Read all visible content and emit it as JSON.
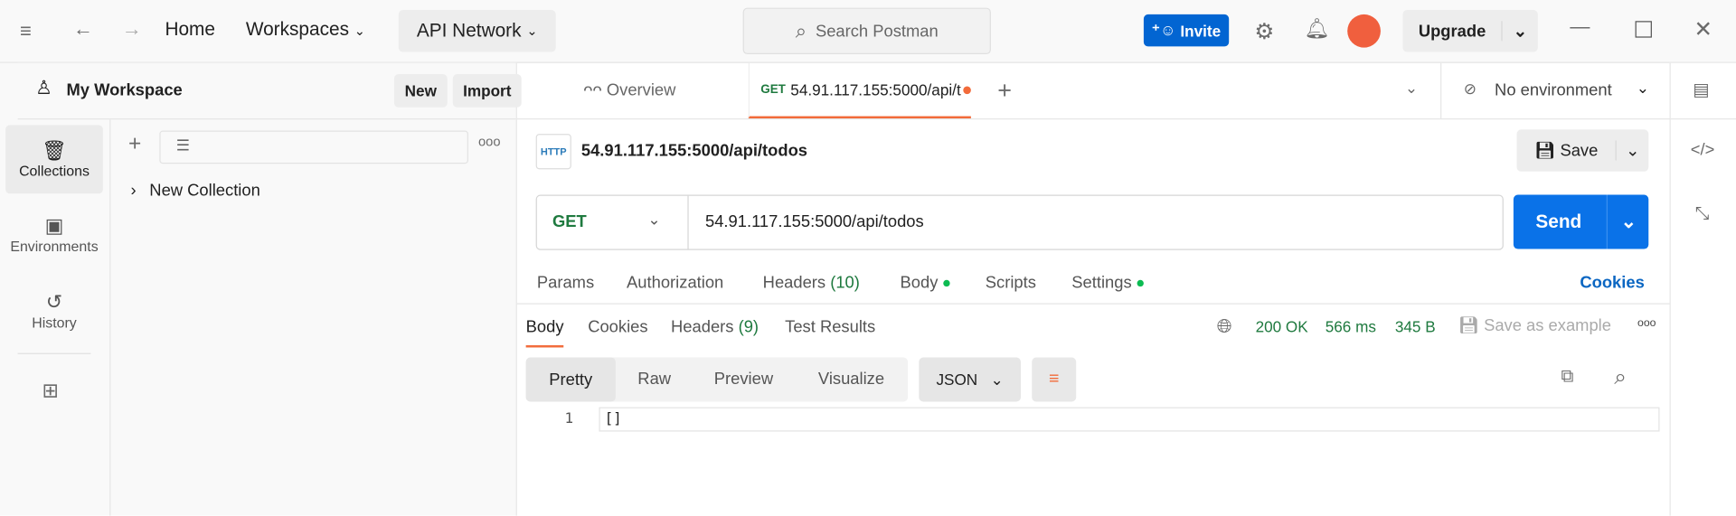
{
  "topbar": {
    "home": "Home",
    "workspaces": "Workspaces",
    "api_network": "API Network",
    "search_placeholder": "Search Postman",
    "invite": "Invite",
    "upgrade": "Upgrade"
  },
  "workspace": {
    "title": "My Workspace",
    "new": "New",
    "import": "Import"
  },
  "nav": [
    {
      "label": "Collections"
    },
    {
      "label": "Environments"
    },
    {
      "label": "History"
    }
  ],
  "collections": [
    {
      "name": "New Collection"
    }
  ],
  "tabs": {
    "overview": "Overview",
    "request_method": "GET",
    "request_title": "54.91.117.155:5000/api/t",
    "environment": "No environment"
  },
  "request": {
    "name": "54.91.117.155:5000/api/todos",
    "method": "GET",
    "url": "54.91.117.155:5000/api/todos",
    "save": "Save",
    "send": "Send",
    "http_badge": "HTTP"
  },
  "request_tabs": [
    "Params",
    "Authorization",
    "Headers",
    "(10)",
    "Body",
    "Scripts",
    "Settings",
    "Cookies"
  ],
  "response": {
    "tabs": [
      "Body",
      "Cookies",
      "Headers",
      "(9)",
      "Test Results"
    ],
    "status": "200 OK",
    "time": "566 ms",
    "size": "345 B",
    "save_example": "Save as example",
    "views": [
      "Pretty",
      "Raw",
      "Preview",
      "Visualize"
    ],
    "format": "JSON",
    "lines": [
      {
        "num": "1",
        "text": "[]"
      }
    ]
  }
}
